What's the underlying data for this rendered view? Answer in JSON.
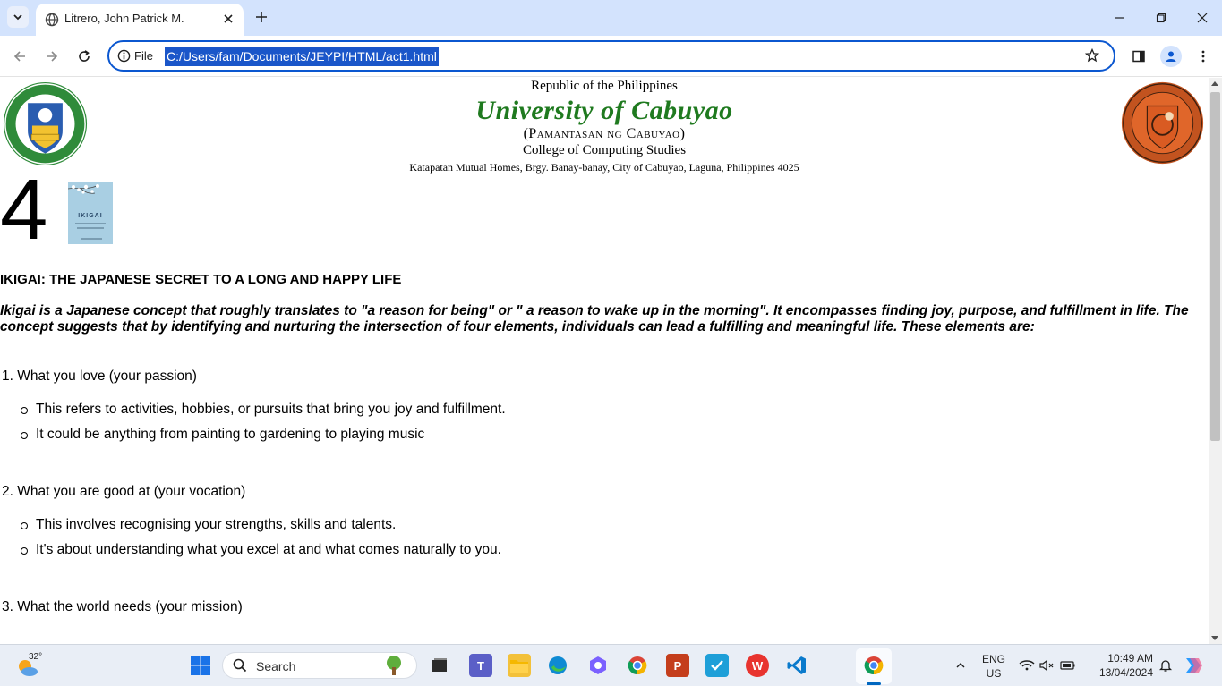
{
  "browser": {
    "tab_title": "Litrero, John Patrick M.",
    "scheme_label": "File",
    "url": "C:/Users/fam/Documents/JEYPI/HTML/act1.html"
  },
  "page": {
    "republic": "Republic of the Philippines",
    "university": "University of Cabuyao",
    "pamantasan": "(Pamantasan ng Cabuyao)",
    "college": "College of Computing Studies",
    "address": "Katapatan Mutual Homes, Brgy. Banay-banay, City of Cabuyao, Laguna, Philippines 4025",
    "big_number": "4",
    "book_title": "IKIGAI",
    "heading": "IKIGAI: THE JAPANESE SECRET TO A LONG AND HAPPY LIFE",
    "intro": "Ikigai is a Japanese concept that roughly translates to \"a reason for being\" or \" a reason to wake up in the morning\". It encompasses finding joy, purpose, and fulfillment in life. The concept suggests that by identifying and nurturing the intersection of four elements, individuals can lead a fulfilling and meaningful life. These elements are:",
    "sections": [
      {
        "title": "1. What you love (your passion)",
        "bullets": [
          "This refers to activities, hobbies, or pursuits that bring you joy and fulfillment.",
          "It could be anything from painting to gardening to playing music"
        ]
      },
      {
        "title": "2. What you are good at (your vocation)",
        "bullets": [
          "This involves recognising your strengths, skills and talents.",
          "It's about understanding what you excel at and what comes naturally to you."
        ]
      },
      {
        "title": "3. What the world needs (your mission)",
        "bullets": []
      }
    ]
  },
  "taskbar": {
    "temperature": "32°",
    "search_label": "Search",
    "language_line1": "ENG",
    "language_line2": "US",
    "time": "10:49 AM",
    "date": "13/04/2024"
  }
}
